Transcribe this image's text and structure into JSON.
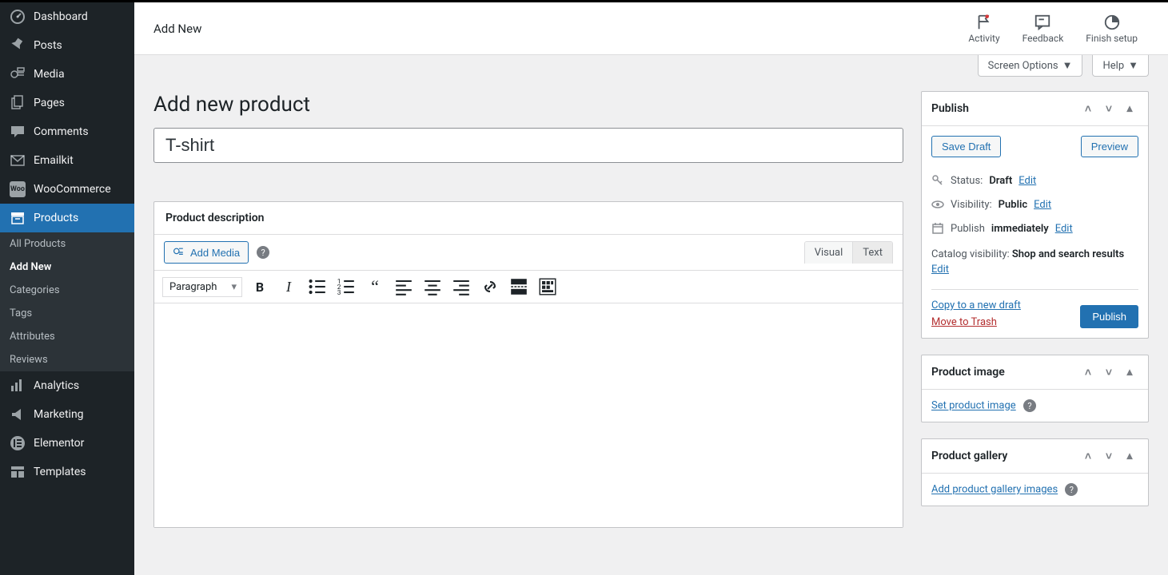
{
  "sidebar": {
    "items": [
      {
        "label": "Dashboard"
      },
      {
        "label": "Posts"
      },
      {
        "label": "Media"
      },
      {
        "label": "Pages"
      },
      {
        "label": "Comments"
      },
      {
        "label": "Emailkit"
      },
      {
        "label": "WooCommerce"
      },
      {
        "label": "Products"
      },
      {
        "label": "Analytics"
      },
      {
        "label": "Marketing"
      },
      {
        "label": "Elementor"
      },
      {
        "label": "Templates"
      }
    ],
    "sub": {
      "items": [
        {
          "label": "All Products"
        },
        {
          "label": "Add New"
        },
        {
          "label": "Categories"
        },
        {
          "label": "Tags"
        },
        {
          "label": "Attributes"
        },
        {
          "label": "Reviews"
        }
      ]
    }
  },
  "topbar": {
    "title": "Add New",
    "actions": {
      "activity": "Activity",
      "feedback": "Feedback",
      "finish_setup": "Finish setup"
    }
  },
  "screen": {
    "options_label": "Screen Options",
    "help_label": "Help"
  },
  "page": {
    "heading": "Add new product",
    "title_value": "T-shirt"
  },
  "editor": {
    "box_title": "Product description",
    "add_media_label": "Add Media",
    "tab_visual": "Visual",
    "tab_text": "Text",
    "format_label": "Paragraph"
  },
  "publish": {
    "title": "Publish",
    "save_draft": "Save Draft",
    "preview": "Preview",
    "status_label": "Status:",
    "status_value": "Draft",
    "visibility_label": "Visibility:",
    "visibility_value": "Public",
    "schedule_label": "Publish",
    "schedule_value": "immediately",
    "catalog_label": "Catalog visibility:",
    "catalog_value": "Shop and search results",
    "edit": "Edit",
    "copy_draft": "Copy to a new draft",
    "move_trash": "Move to Trash",
    "publish_btn": "Publish"
  },
  "product_image": {
    "title": "Product image",
    "set_link": "Set product image"
  },
  "product_gallery": {
    "title": "Product gallery",
    "add_link": "Add product gallery images"
  }
}
